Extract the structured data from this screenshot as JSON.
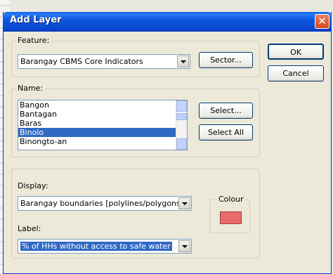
{
  "window": {
    "title": "Add Layer",
    "close_glyph": "✕"
  },
  "feature": {
    "legend": "Feature:",
    "selected": "Barangay CBMS Core Indicators",
    "sector_button": "Sector..."
  },
  "name": {
    "legend": "Name:",
    "items": [
      "Bangon",
      "Bantagan",
      "Baras",
      "Binolo",
      "Binongto-an"
    ],
    "selected_index": 3,
    "select_button": "Select...",
    "select_all_button": "Select All"
  },
  "display": {
    "label": "Display:",
    "selected": "Barangay boundaries [polylines/polygons]"
  },
  "label_field": {
    "label": "Label:",
    "selected": "% of HHs without access to safe water"
  },
  "colour": {
    "legend": "Colour",
    "value": "#e86a6a"
  },
  "buttons": {
    "ok": "OK",
    "cancel": "Cancel"
  }
}
